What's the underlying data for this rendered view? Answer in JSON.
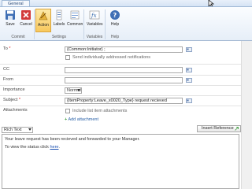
{
  "ribbon": {
    "tab": "General",
    "buttons": {
      "save": "Save",
      "cancel": "Cancel",
      "action": "Action",
      "labels": "Labels",
      "common": "Common",
      "variables": "Variables",
      "help": "Help"
    },
    "groups": {
      "commit": "Commit",
      "settings": "Settings",
      "variables": "Variables",
      "help": "Help"
    }
  },
  "form": {
    "to": {
      "label": "To",
      "value": "{Common:Initiator} ;",
      "send_individual": "Send individually addressed notifications"
    },
    "cc": {
      "label": "CC",
      "value": ""
    },
    "from": {
      "label": "From",
      "value": ""
    },
    "importance": {
      "label": "Importance",
      "value": "Normal"
    },
    "subject": {
      "label": "Subject",
      "value": "{ItemProperty:Leave_x0020_Type} request recieved"
    },
    "attachments": {
      "label": "Attachments",
      "include_list": "Include list item attachments",
      "add": "Add attachment"
    },
    "editor": {
      "format": "Rich Text",
      "insert_reference": "Insert Reference",
      "body_line1": "Your leave request has been recieved and forwarded to your Manager.",
      "body_line2_prefix": "To view the status click ",
      "body_link": "here",
      "body_line2_suffix": "."
    }
  },
  "colors": {
    "accent": "#2b62a8",
    "required": "#dd2222",
    "active_button": "#f8c85c"
  }
}
